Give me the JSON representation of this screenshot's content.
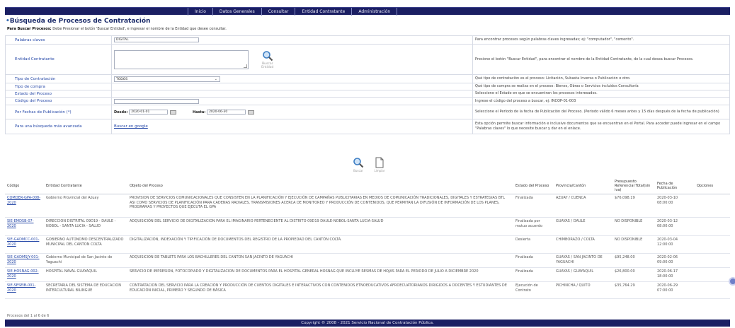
{
  "nav": {
    "items": [
      "Inicio",
      "Datos Generales",
      "Consultar",
      "Entidad Contratante",
      "Administración"
    ]
  },
  "page": {
    "title": "Búsqueda de Procesos de Contratación",
    "howto_label": "Para Buscar Procesos:",
    "howto_text": " Debe Presionar el botón 'Buscar Entidad', e ingresar el nombre de la Entidad que desee consultar."
  },
  "form": {
    "palabras": {
      "label": "Palabras claves",
      "value": "DIGITAL",
      "help": "Para encontrar procesos según palabras claves ingresadas; ej: \"computador\", \"cemento\"."
    },
    "entidad": {
      "label": "Entidad Contratante",
      "button_label": "Buscar Entidad",
      "help": "Presione el botón \"Buscar Entidad\", para encontrar el nombre de la Entidad Contratante, de la cual desea buscar Procesos."
    },
    "tipo_contratacion": {
      "label": "Tipo de Contratación",
      "value": "TODOS",
      "help": "Qué tipo de contratación es el proceso: Licitación, Subasta Inversa o Publicación o otro."
    },
    "tipo_compra": {
      "label": "Tipo de compra",
      "help": "Qué tipo de compra se realiza en el proceso: Bienes, Obras o Servicios incluidos Consultoría"
    },
    "estado": {
      "label": "Estado del Proceso",
      "help": "Seleccione el Estado en que se encuentran los procesos interesados."
    },
    "codigo": {
      "label": "Código del Proceso",
      "help": "Ingrese el código del proceso a buscar, ej: INCOP-01-003"
    },
    "fechas": {
      "label": "Por Fechas de Publicación (*)",
      "desde_label": "Desde:",
      "desde_value": "2020-01-01",
      "hasta_label": "Hasta:",
      "hasta_value": "2020-06-30",
      "help": "Seleccione el Período de la fecha de Publicación del Proceso. (Periodo válido 6 meses antes y 15 días después de la fecha de publicación)"
    },
    "avanzada": {
      "label": "Para una búsqueda más avanzada",
      "link": "Buscar en google",
      "help": "Esta opción permite buscar información e inclusive documentos que se encuentran en el Portal. Para acceder puede ingresar en el campo \"Palabras claves\" lo que necesite buscar y dar en el enlace."
    }
  },
  "actions": {
    "buscar": "Buscar",
    "limpiar": "Limpiar"
  },
  "results": {
    "headers": [
      "Código",
      "Entidad Contratante",
      "Objeto del Proceso",
      "Estado del Proceso",
      "Provincia/Cantón",
      "Presupuesto Referencial Total(sin iva)",
      "Fecha de Publicación",
      "Opciones"
    ],
    "rows": [
      [
        "COMDER-GPA-008-2020",
        "Gobierno Provincial del Azuay",
        "PROVISION DE SERVICIOS COMUNICACIONALES QUE CONSISTEN EN LA PLANIFICACIÓN Y EJECUCIÓN DE CAMPAÑAS PUBLICITARIAS EN MEDIOS DE COMUNICACIÓN TRADICIONALES, DIGITALES Y ESTRATEGIAS BTL ASI COMO SERVICIOS DE PLANIFICACIÓN PARA CADENAS RADIALES, TRANSMISIONES ACERCA DE MONITOREO Y PRODUCCIÓN DE CONTENIDOS, QUE PERMITAN LA DIFUSIÓN DE INFORMACIÓN DE LOS PLANES, PROGRAMAS Y PROYECTOS QUE EJECUTA EL GPA",
        "Finalizada",
        "AZUAY / CUENCA",
        "$76,098.19",
        "2020-03-10 08:00:00",
        ""
      ],
      [
        "SIE-EMDSB-07-2020",
        "DIRECCION DISTRITAL 09D19 - DAULE - NOBOL - SANTA LUCIA - SALUD",
        "ADQUISICIÓN DEL SERVICIO DE DIGITALIZACION PARA EL IMAGINARIO PERTENECIENTE AL DISTRITO 09D19 DAULE-NOBOL-SANTA LUCIA-SALUD",
        "Finalizada por mutuo acuerdo",
        "GUAYAS / DAULE",
        "NO DISPONIBLE",
        "2020-03-12 08:00:00",
        ""
      ],
      [
        "SIE-GADMCC-001-2020",
        "GOBIERNO AUTONOMO DESCENTRALIZADO MUNICIPAL DEL CANTON COLTA",
        "DIGITALIZACIÓN, INDEXACIÓN Y TIPIFICACIÓN DE DOCUMENTOS DEL REGISTRO DE LA PROPIEDAD DEL CANTÓN COLTA.",
        "Desierta",
        "CHIMBORAZO / COLTA",
        "NO DISPONIBLE",
        "2020-03-04 12:00:00",
        ""
      ],
      [
        "SIE-GADMSJY-001-2020",
        "Gobierno Municipal de San Jacinto de Yaguachi",
        "ADQUISICION DE TABLETS PARA LOS BACHILLERES DEL CANTON SAN JACINTO DE YAGUACHI",
        "Finalizada",
        "GUAYAS / SAN JACINTO DE YAGUACHI",
        "$95,248.00",
        "2020-02-06 09:00:00",
        ""
      ],
      [
        "SIE-HOSNAG-002-2020",
        "HOSPITAL NAVAL GUAYAQUIL",
        "SERVICIO DE IMPRESION, FOTOCOPIADO Y DIGITALIZACION DE DOCUMENTOS PARA EL HOSPITAL GENERAL HOSNAG QUE INCLUYE RESMAS DE HOJAS PARA EL PERIODO DE JULIO A DICIEMBRE 2020",
        "Finalizada",
        "GUAYAS / GUAYAQUIL",
        "$26,800.00",
        "2020-06-17 18:00:00",
        ""
      ],
      [
        "SIE-SESEIB-001-2020",
        "SECRETARIA DEL SISTEMA DE EDUCACION INTERCULTURAL BILINGUE",
        "CONTRATACION DEL SERVICIO PARA LA CREACIÓN Y PRODUCCIÓN DE CUENTOS DIGITALES E INTERACTIVOS CON CONTENIDOS ETNOEDUCATIVOS AFROECUATORIANOS DIRIGIDOS A DOCENTES Y ESTUDIANTES DE EDUCACIÓN INICIAL, PRIMERO Y SEGUNDO DE BÁSICA",
        "Ejecución de Contrato",
        "PICHINCHA / QUITO",
        "$35,764.29",
        "2020-06-29 07:00:00",
        ""
      ]
    ]
  },
  "count_text": "Procesos del 1 al 6 de 6",
  "footer": "Copyright © 2008 - 2021 Servicio Nacional de Contratación Pública.",
  "colors": {
    "nav_bg": "#1b1f63",
    "link": "#2749a8",
    "title": "#1b2b6a"
  }
}
